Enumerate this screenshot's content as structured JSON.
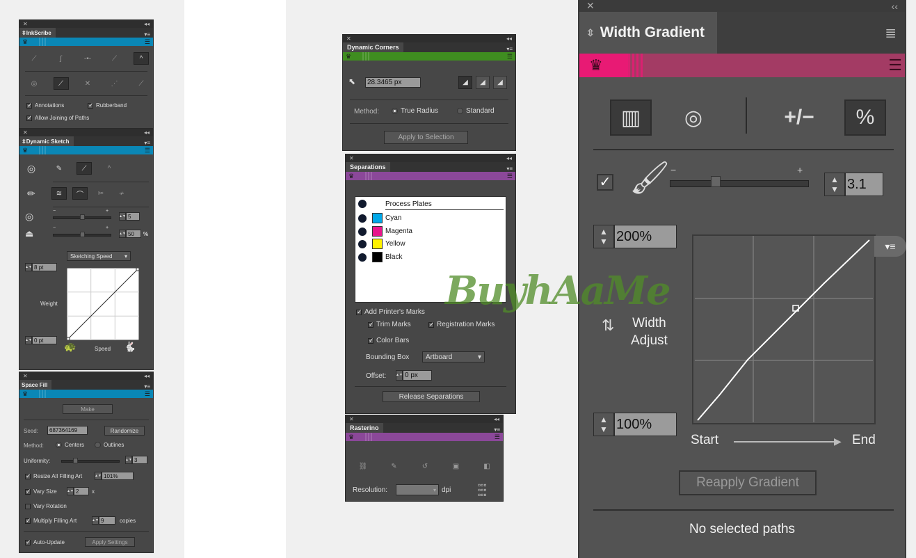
{
  "inkscribe": {
    "title": "InkScribe",
    "tools_row1": [
      "smooth-point-icon",
      "curve-point-icon",
      "add-point-icon",
      "corner-point-icon",
      "angle-point-icon"
    ],
    "tools_row2": [
      "annotation-icon",
      "edit-handle-icon",
      "cut-icon",
      "dotted-path-icon",
      "extend-path-icon"
    ],
    "annotations_label": "Annotations",
    "annotations_checked": true,
    "rubberband_label": "Rubberband",
    "rubberband_checked": true,
    "allow_joining_label": "Allow Joining of Paths",
    "allow_joining_checked": true
  },
  "dynamic_sketch": {
    "title": "Dynamic Sketch",
    "smoothness_value": "5",
    "fidelity_value": "50",
    "fidelity_unit": "%",
    "minus": "−",
    "plus": "+",
    "speed_dropdown": "Sketching Speed",
    "max_weight": "8 pt",
    "min_weight": "0 pt",
    "weight_label": "Weight",
    "speed_label": "Speed"
  },
  "space_fill": {
    "title": "Space Fill",
    "make_label": "Make",
    "seed_label": "Seed:",
    "seed_value": "687364169",
    "randomize_label": "Randomize",
    "method_label": "Method:",
    "method_centers": "Centers",
    "method_outlines": "Outlines",
    "uniformity_label": "Uniformity:",
    "uniformity_value": "3",
    "resize_label": "Resize All Filling Art",
    "resize_value": "101%",
    "vary_size_label": "Vary Size",
    "vary_size_value": "2",
    "vary_size_unit": "x",
    "vary_rotation_label": "Vary Rotation",
    "multiply_label": "Multiply Filling Art",
    "multiply_value": "9",
    "multiply_unit": "copies",
    "auto_update_label": "Auto-Update",
    "apply_label": "Apply Settings"
  },
  "dynamic_corners": {
    "title": "Dynamic Corners",
    "radius_value": "28.3465 px",
    "method_label": "Method:",
    "method_true_radius": "True Radius",
    "method_standard": "Standard",
    "apply_label": "Apply to Selection"
  },
  "separations": {
    "title": "Separations",
    "header": "Process Plates",
    "plates": [
      {
        "name": "Cyan",
        "color": "#00a8e8"
      },
      {
        "name": "Magenta",
        "color": "#e8168c"
      },
      {
        "name": "Yellow",
        "color": "#fff200"
      },
      {
        "name": "Black",
        "color": "#000000"
      }
    ],
    "printers_marks_label": "Add Printer's Marks",
    "trim_marks_label": "Trim Marks",
    "registration_marks_label": "Registration Marks",
    "color_bars_label": "Color Bars",
    "bounding_box_label": "Bounding Box",
    "bounding_box_value": "Artboard",
    "offset_label": "Offset:",
    "offset_value": "0 px",
    "release_label": "Release Separations"
  },
  "rasterino": {
    "title": "Rasterino",
    "resolution_label": "Resolution:",
    "resolution_value": "",
    "resolution_unit": "dpi"
  },
  "width_gradient": {
    "title": "Width Gradient",
    "brush_value": "3.1",
    "max_value": "200%",
    "min_value": "100%",
    "width_adjust_label_1": "Width",
    "width_adjust_label_2": "Adjust",
    "start_label": "Start",
    "end_label": "End",
    "reapply_label": "Reapply Gradient",
    "status": "No selected paths",
    "minus": "−",
    "plus": "+"
  },
  "watermark": "BuyhAaMe",
  "colors": {
    "inkscribe_band": "#0a87b6",
    "corners_band": "#3f8d20",
    "separations_band": "#8b4899",
    "gradient_band": "#a33b64"
  }
}
